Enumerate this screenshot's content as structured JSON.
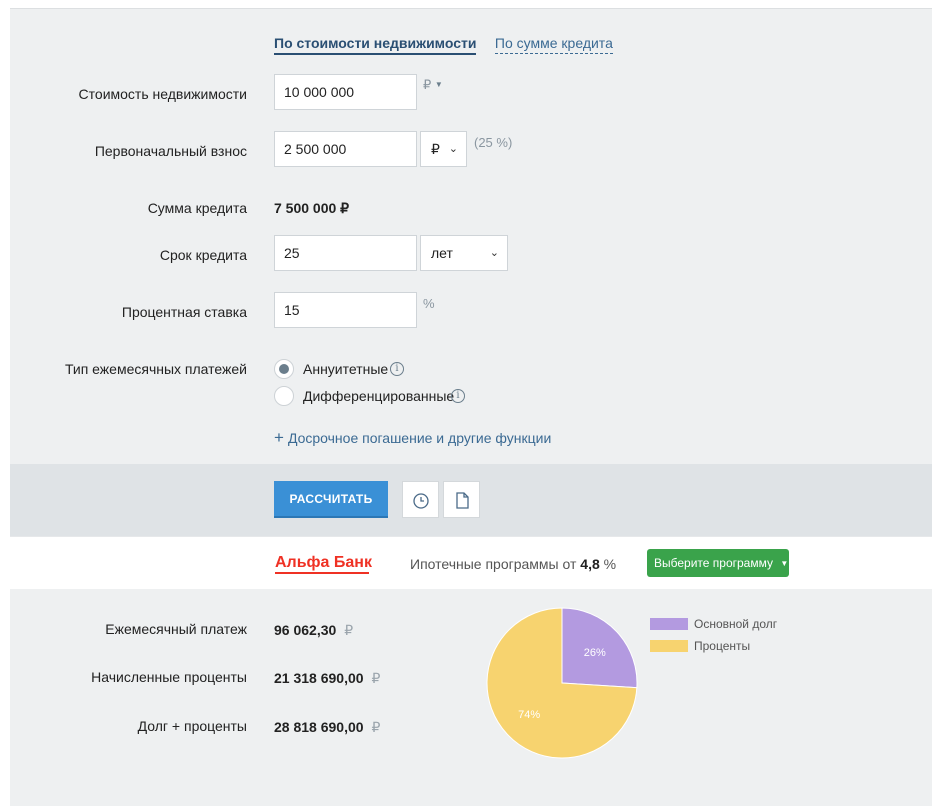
{
  "tabs": {
    "by_property_price": "По стоимости недвижимости",
    "by_loan_amount": "По сумме кредита"
  },
  "form": {
    "property_price": {
      "label": "Стоимость недвижимости",
      "value": "10 000 000",
      "currency": "₽"
    },
    "down_payment": {
      "label": "Первоначальный взнос",
      "value": "2 500 000",
      "unit_select": "₽",
      "percent_note": "(25 %)"
    },
    "loan_amount": {
      "label": "Сумма кредита",
      "value": "7 500 000 ₽"
    },
    "loan_term": {
      "label": "Срок кредита",
      "value": "25",
      "unit_select": "лет"
    },
    "interest_rate": {
      "label": "Процентная ставка",
      "value": "15",
      "unit": "%"
    },
    "payment_type": {
      "label": "Тип ежемесячных платежей",
      "options": [
        "Аннуитетные",
        "Дифференцированные"
      ],
      "selected": "Аннуитетные"
    },
    "more_link": "Досрочное погашение и другие функции"
  },
  "actions": {
    "calculate_label": "РАССЧИТАТЬ"
  },
  "promo": {
    "bank_name": "Альфа Банк",
    "text_prefix": "Ипотечные программы от",
    "rate": "4,8",
    "rate_unit": "%",
    "button_label": "Выберите программу"
  },
  "results": {
    "currency": "₽",
    "monthly_payment": {
      "label": "Ежемесячный платеж",
      "value": "96 062,30"
    },
    "accrued_interest": {
      "label": "Начисленные проценты",
      "value": "21 318 690,00"
    },
    "debt_plus_interest": {
      "label": "Долг + проценты",
      "value": "28 818 690,00"
    }
  },
  "chart_data": {
    "type": "pie",
    "series": [
      {
        "name": "Основной долг",
        "value": 26,
        "label": "26%",
        "color": "#b39ae0"
      },
      {
        "name": "Проценты",
        "value": 74,
        "label": "74%",
        "color": "#f7d36f"
      }
    ]
  }
}
